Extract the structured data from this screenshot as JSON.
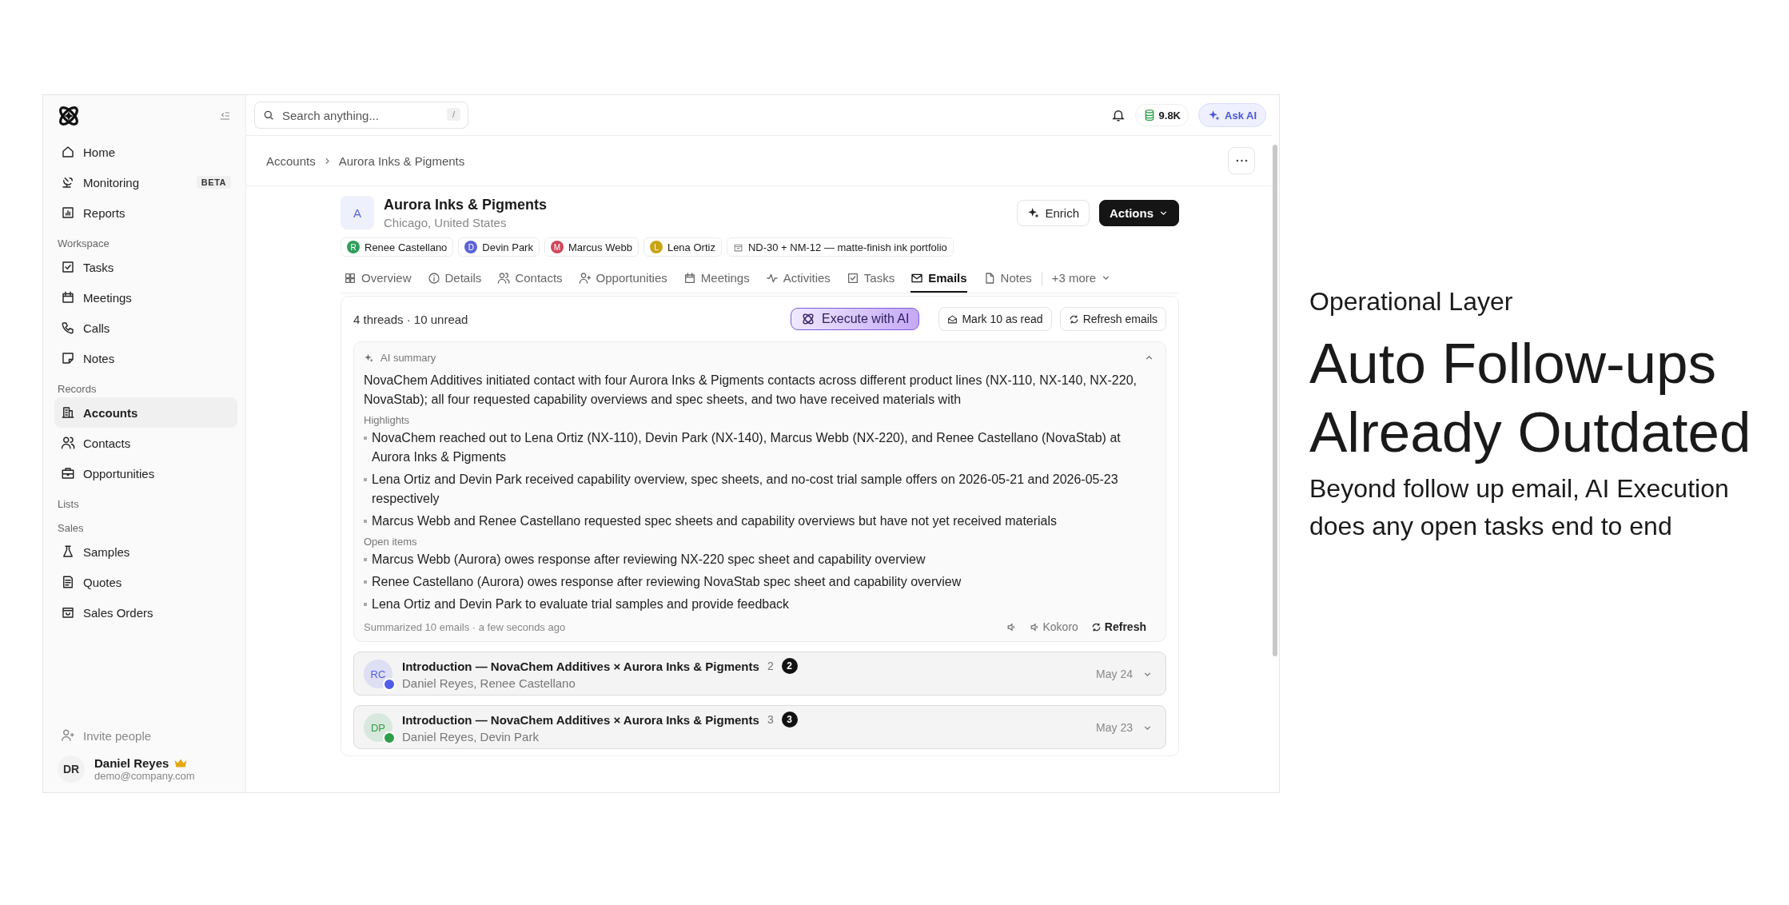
{
  "app": {
    "sidebar": {
      "sections": [
        {
          "items": [
            {
              "label": "Home",
              "selected": false
            },
            {
              "label": "Monitoring",
              "selected": false,
              "badge": "BETA"
            },
            {
              "label": "Reports",
              "selected": false
            }
          ]
        },
        {
          "heading": "Workspace",
          "items": [
            {
              "label": "Tasks",
              "selected": false
            },
            {
              "label": "Meetings",
              "selected": false
            },
            {
              "label": "Calls",
              "selected": false
            },
            {
              "label": "Notes",
              "selected": false
            }
          ]
        },
        {
          "heading": "Records",
          "items": [
            {
              "label": "Accounts",
              "selected": true
            },
            {
              "label": "Contacts",
              "selected": false
            },
            {
              "label": "Opportunities",
              "selected": false
            }
          ]
        },
        {
          "heading": "Lists"
        },
        {
          "heading": "Sales",
          "items": [
            {
              "label": "Samples",
              "selected": false
            },
            {
              "label": "Quotes",
              "selected": false
            },
            {
              "label": "Sales Orders",
              "selected": false
            }
          ]
        }
      ],
      "invite": "Invite people",
      "user": {
        "initials": "DR",
        "name": "Daniel Reyes",
        "email": "demo@company.com"
      }
    },
    "topbar": {
      "search_placeholder": "Search anything...",
      "shortcut": "/",
      "credits": "9.8K",
      "ask_ai": "Ask AI"
    },
    "breadcrumb": [
      "Accounts",
      "Aurora Inks & Pigments"
    ],
    "account": {
      "avatar": "A",
      "name": "Aurora Inks & Pigments",
      "location": "Chicago, United States",
      "enrich": "Enrich",
      "actions": "Actions",
      "contacts": [
        {
          "initial": "R",
          "name": "Renee Castellano",
          "color": "#2e9e5b"
        },
        {
          "initial": "D",
          "name": "Devin Park",
          "color": "#5b63d8"
        },
        {
          "initial": "M",
          "name": "Marcus Webb",
          "color": "#d0465a"
        },
        {
          "initial": "L",
          "name": "Lena Ortiz",
          "color": "#c9a514"
        }
      ],
      "product": "ND-30 + NM-12 — matte-finish ink portfolio"
    },
    "tabs": [
      {
        "label": "Overview",
        "selected": false
      },
      {
        "label": "Details",
        "selected": false
      },
      {
        "label": "Contacts",
        "selected": false
      },
      {
        "label": "Opportunities",
        "selected": false
      },
      {
        "label": "Meetings",
        "selected": false
      },
      {
        "label": "Activities",
        "selected": false
      },
      {
        "label": "Tasks",
        "selected": false
      },
      {
        "label": "Emails",
        "selected": true
      },
      {
        "label": "Notes",
        "selected": false
      }
    ],
    "more_tabs": "+3 more",
    "emails": {
      "status": "4 threads · 10 unread",
      "execute": "Execute with AI",
      "mark_read": "Mark 10 as read",
      "refresh": "Refresh emails",
      "summary": {
        "title": "AI summary",
        "expanded": true,
        "text": "NovaChem Additives initiated contact with four Aurora Inks & Pigments contacts across different product lines (NX-110, NX-140, NX-220, NovaStab); all four requested capability overviews and spec sheets, and two have received materials with",
        "groups": [
          {
            "heading": "Highlights",
            "items": [
              "NovaChem reached out to Lena Ortiz (NX-110), Devin Park (NX-140), Marcus Webb (NX-220), and Renee Castellano (NovaStab) at Aurora Inks & Pigments",
              "Lena Ortiz and Devin Park received capability overview, spec sheets, and no-cost trial sample offers on 2026-05-21 and 2026-05-23 respectively",
              "Marcus Webb and Renee Castellano requested spec sheets and capability overviews but have not yet received materials"
            ]
          },
          {
            "heading": "Open items",
            "items": [
              "Marcus Webb (Aurora) owes response after reviewing NX-220 spec sheet and capability overview",
              "Renee Castellano (Aurora) owes response after reviewing NovaStab spec sheet and capability overview",
              "Lena Ortiz and Devin Park to evaluate trial samples and provide feedback"
            ]
          }
        ],
        "footer": "Summarized 10 emails · a few seconds ago",
        "voice": "Kokoro",
        "refresh": "Refresh"
      },
      "threads": [
        {
          "initials": "RC",
          "subject": "Introduction — NovaChem Additives × Aurora Inks & Pigments",
          "count": "2",
          "unread": "2",
          "participants": "Daniel Reyes, Renee Castellano",
          "date": "May 24",
          "color": "#4f5de8"
        },
        {
          "initials": "DP",
          "subject": "Introduction — NovaChem Additives × Aurora Inks & Pigments",
          "count": "3",
          "unread": "3",
          "participants": "Daniel Reyes, Devin Park",
          "date": "May 23",
          "color": "#2e9e4a"
        }
      ]
    }
  },
  "caption": {
    "eyebrow": "Operational Layer",
    "headline": [
      "Auto Follow-ups",
      "Already Outdated"
    ],
    "body": "Beyond follow up email, AI Execution does any open tasks end to end"
  }
}
